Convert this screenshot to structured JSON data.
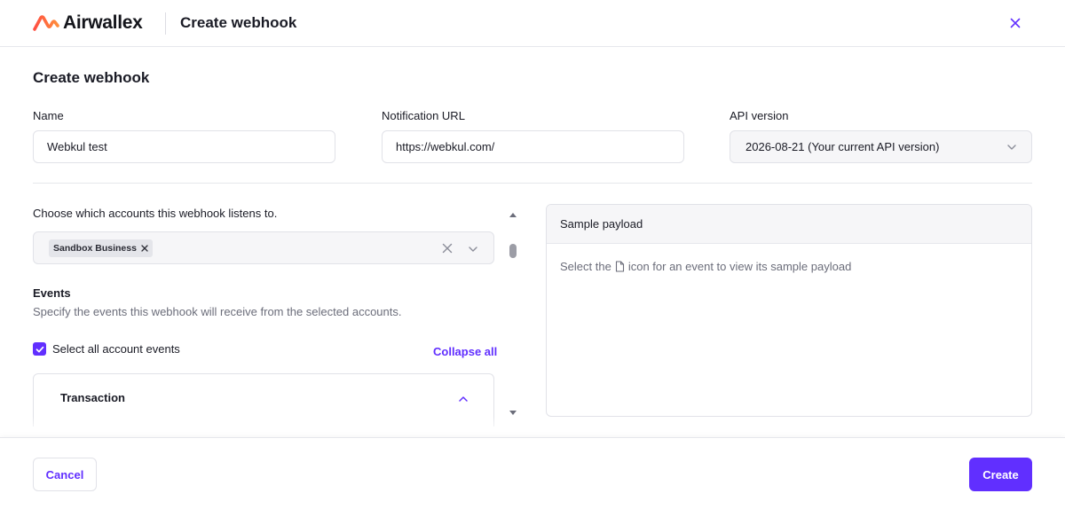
{
  "header": {
    "brand": "Airwallex",
    "title": "Create webhook",
    "close_icon": "close-icon"
  },
  "form": {
    "heading": "Create webhook",
    "name": {
      "label": "Name",
      "value": "Webkul test"
    },
    "notification_url": {
      "label": "Notification URL",
      "value": "https://webkul.com/"
    },
    "api_version": {
      "label": "API version",
      "value": "2026-08-21 (Your current API version)"
    }
  },
  "accounts": {
    "label": "Choose which accounts this webhook listens to.",
    "selected": [
      "Sandbox Business"
    ]
  },
  "events": {
    "title": "Events",
    "description": "Specify the events this webhook will receive from the selected accounts.",
    "select_all_label": "Select all account events",
    "select_all_checked": true,
    "collapse_all_label": "Collapse all",
    "groups": [
      {
        "title": "Transaction",
        "expanded": true
      }
    ]
  },
  "payload": {
    "title": "Sample payload",
    "hint_before": "Select the",
    "hint_after": "icon for an event to view its sample payload",
    "hint_icon": "document-icon"
  },
  "footer": {
    "cancel_label": "Cancel",
    "create_label": "Create"
  },
  "colors": {
    "accent": "#612fff",
    "logo_gradient_start": "#ff4f42",
    "logo_gradient_end": "#ff8e3c"
  }
}
